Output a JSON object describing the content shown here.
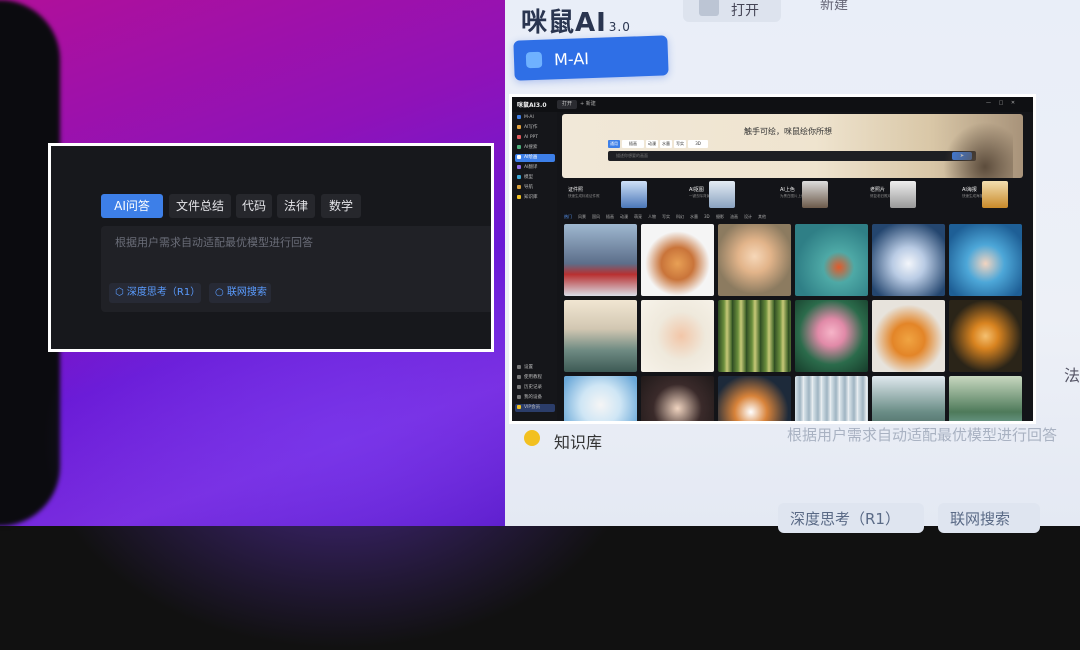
{
  "background_app": {
    "brand": "咪鼠AI",
    "brand_version": "3.0",
    "open_label": "打开",
    "new_label": "新建",
    "mai_label": "M-AI",
    "knowledge_label": "知识库",
    "hint_text": "根据用户需求自动适配最优模型进行回答",
    "law_label": "法",
    "deep_think": "深度思考（R1）",
    "web_search": "联网搜索"
  },
  "chat_panel": {
    "tabs": [
      "AI问答",
      "文件总结",
      "代码",
      "法律",
      "数学"
    ],
    "placeholder": "根据用户需求自动适配最优模型进行回答",
    "deep_think": "深度思考（R1）",
    "web_search": "联网搜索"
  },
  "app_panel": {
    "brand": "咪鼠AI3.0",
    "tab_open": "打开",
    "tab_new": "+ 新建",
    "window_controls": "— □ ✕",
    "sidebar": [
      "M-AI",
      "AI写作",
      "AI PPT",
      "AI搜索",
      "AI绘画",
      "AI翻译",
      "模型",
      "导航",
      "知识库"
    ],
    "sidebar_bottom": [
      "设置",
      "使用教程",
      "历史记录",
      "我的设备",
      "VIP会员"
    ],
    "hero_title": "触手可绘，咪鼠绘你所想",
    "hero_tabs": [
      "通用",
      "插画",
      "动漫",
      "水墨",
      "写实",
      "3D"
    ],
    "hero_placeholder": "描述你想要的画面",
    "send_label": "➤",
    "features": [
      {
        "title": "证件照",
        "sub": "快速生成标准证件照"
      },
      {
        "title": "AI抠图",
        "sub": "一键去除背景"
      },
      {
        "title": "AI上色",
        "sub": "为黑白图片上色"
      },
      {
        "title": "老照片",
        "sub": "修复老旧照片"
      },
      {
        "title": "AI海报",
        "sub": "快速生成海报"
      }
    ],
    "categories": [
      "热门",
      "风景",
      "国风",
      "插画",
      "动漫",
      "萌宠",
      "人物",
      "写实",
      "科幻",
      "水墨",
      "3D",
      "摄影",
      "油画",
      "设计",
      "其他"
    ]
  },
  "colors": {
    "accent": "#3d7fe8",
    "panel_bg": "#17181c"
  }
}
